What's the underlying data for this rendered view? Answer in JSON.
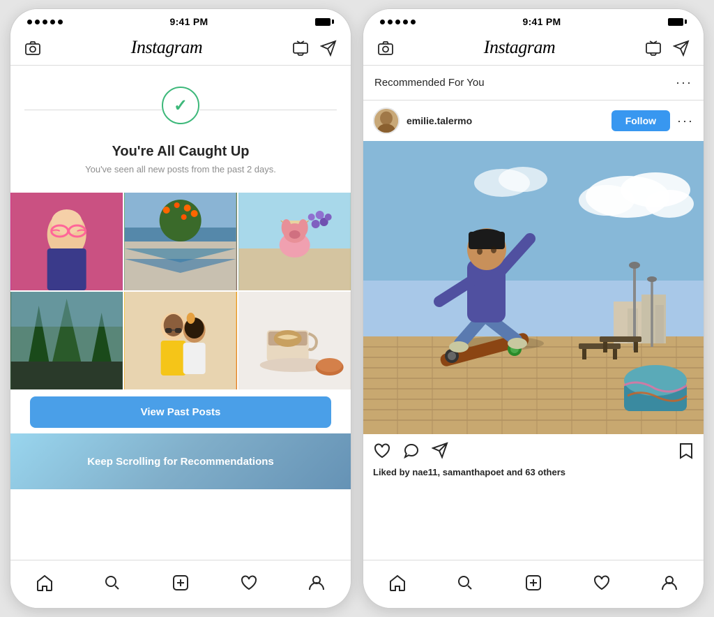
{
  "left_phone": {
    "status": {
      "time": "9:41 PM"
    },
    "nav": {
      "logo": "Instagram"
    },
    "caught_up": {
      "title": "You're All Caught Up",
      "subtitle": "You've seen all new posts from the past 2 days."
    },
    "view_past_btn": "View Past Posts",
    "keep_scrolling": "Keep Scrolling for Recommendations",
    "tabs": {
      "home": "⌂",
      "search": "○",
      "add": "+",
      "heart": "♡",
      "profile": "◯"
    }
  },
  "right_phone": {
    "status": {
      "time": "9:41 PM"
    },
    "nav": {
      "logo": "Instagram"
    },
    "recommended_header": {
      "title": "Recommended For You",
      "dots": "···"
    },
    "post": {
      "username": "emilie.talermo",
      "follow_btn": "Follow",
      "dots": "···",
      "likes_text": "Liked by",
      "likes_users": "nae11, samanthapoet",
      "likes_count": "and 63 others"
    },
    "tabs": {
      "home": "⌂",
      "search": "○",
      "add": "+",
      "heart": "♡",
      "profile": "◯"
    }
  }
}
